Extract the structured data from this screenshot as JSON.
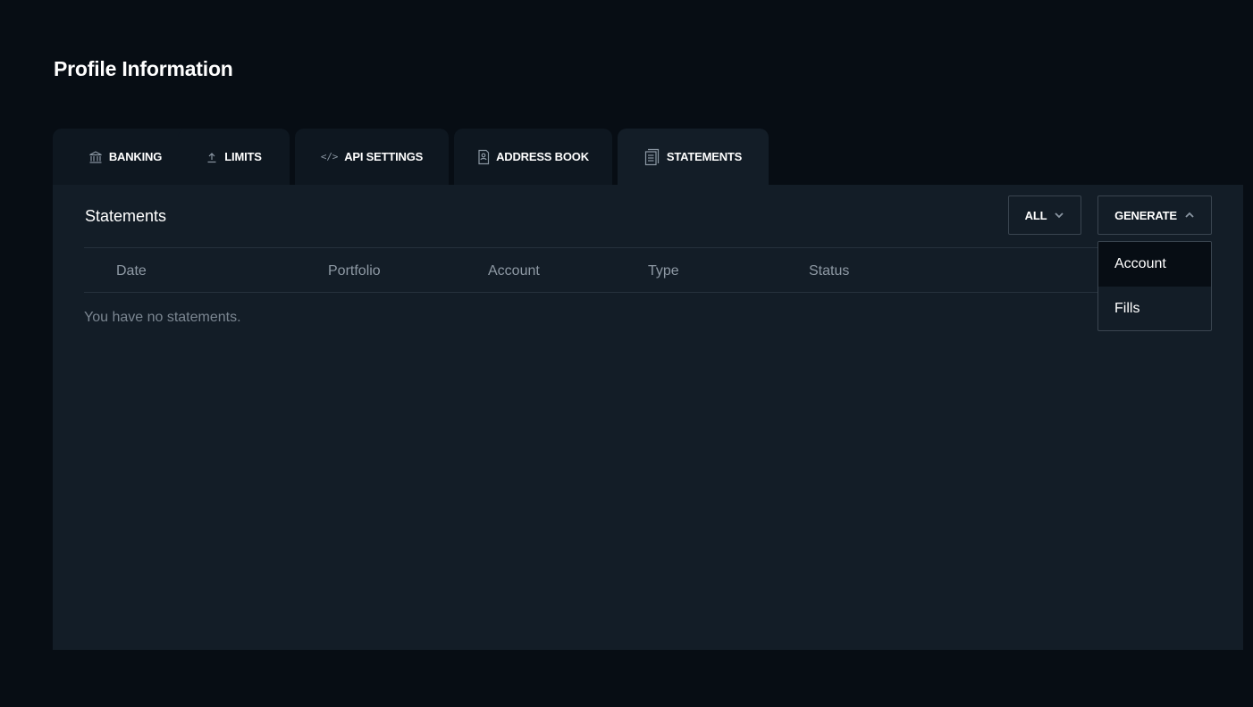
{
  "page": {
    "title": "Profile Information"
  },
  "tabs": [
    {
      "label": "BANKING",
      "icon": "bank-icon",
      "active": false
    },
    {
      "label": "LIMITS",
      "icon": "upload-arrow-icon",
      "active": false
    },
    {
      "label": "API SETTINGS",
      "icon": "code-icon",
      "active": false
    },
    {
      "label": "ADDRESS BOOK",
      "icon": "address-book-icon",
      "active": false
    },
    {
      "label": "STATEMENTS",
      "icon": "statements-icon",
      "active": true
    }
  ],
  "statements": {
    "title": "Statements",
    "filter_button": {
      "label": "ALL",
      "icon": "chevron-down-icon"
    },
    "generate_button": {
      "label": "GENERATE",
      "icon": "chevron-up-icon"
    },
    "columns": [
      "Date",
      "Portfolio",
      "Account",
      "Type",
      "Status"
    ],
    "empty_message": "You have no statements."
  },
  "generate_menu": {
    "items": [
      "Account",
      "Fills"
    ]
  },
  "colors": {
    "background": "#070d14",
    "panel": "#131d27",
    "tab_inactive": "#0e1720",
    "border": "#3a4550",
    "muted_text": "#8e99a4"
  }
}
